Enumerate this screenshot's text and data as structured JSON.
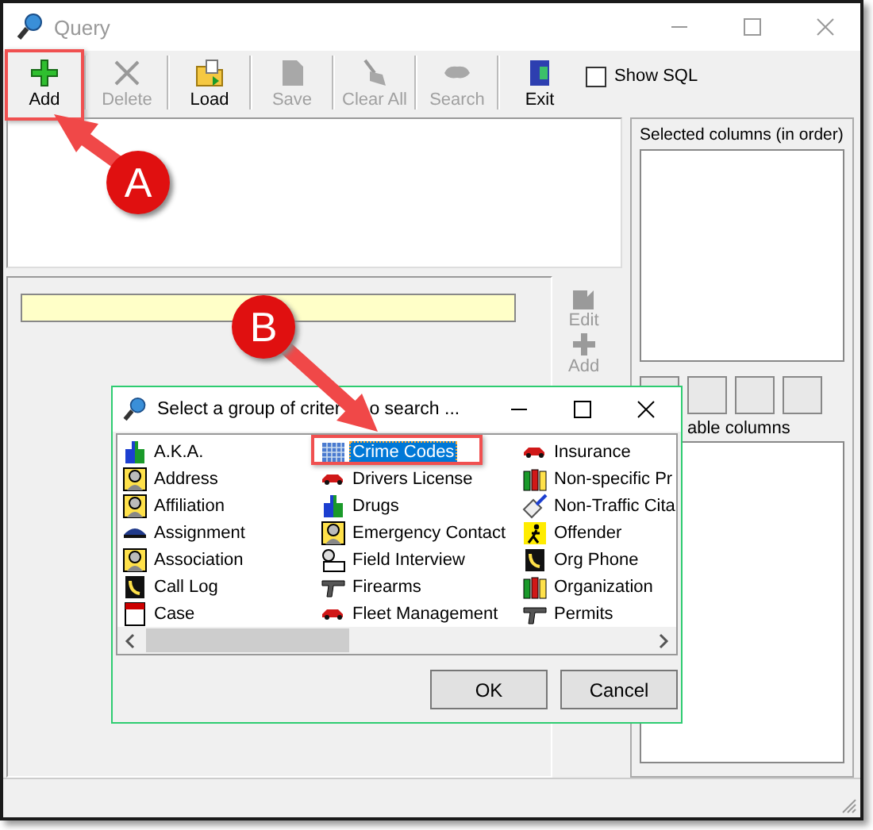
{
  "window": {
    "title": "Query"
  },
  "toolbar": [
    {
      "label": "Add",
      "disabled": false
    },
    {
      "label": "Delete",
      "disabled": true
    },
    {
      "label": "Load",
      "disabled": false
    },
    {
      "label": "Save",
      "disabled": true
    },
    {
      "label": "Clear All",
      "disabled": true
    },
    {
      "label": "Search",
      "disabled": true
    },
    {
      "label": "Exit",
      "disabled": false
    }
  ],
  "show_sql": {
    "label": "Show SQL",
    "checked": false
  },
  "side_buttons": [
    {
      "label": "Edit",
      "disabled": true
    },
    {
      "label": "Add",
      "disabled": true
    }
  ],
  "right_panel": {
    "selected_label": "Selected columns (in order)",
    "available_label": "able columns"
  },
  "dialog": {
    "title_parts": [
      "Select a group of criter",
      "o search ..."
    ],
    "items": [
      {
        "label": "A.K.A.",
        "selected": false
      },
      {
        "label": "Address",
        "selected": false
      },
      {
        "label": "Affiliation",
        "selected": false
      },
      {
        "label": "Assignment",
        "selected": false
      },
      {
        "label": "Association",
        "selected": false
      },
      {
        "label": "Call Log",
        "selected": false
      },
      {
        "label": "Case",
        "selected": false
      },
      {
        "label": "Crime Codes",
        "selected": true
      },
      {
        "label": "Drivers License",
        "selected": false
      },
      {
        "label": "Drugs",
        "selected": false
      },
      {
        "label": "Emergency Contact",
        "selected": false
      },
      {
        "label": "Field Interview",
        "selected": false
      },
      {
        "label": "Firearms",
        "selected": false
      },
      {
        "label": "Fleet Management",
        "selected": false
      },
      {
        "label": "Insurance",
        "selected": false
      },
      {
        "label": "Non-specific Pr",
        "selected": false
      },
      {
        "label": "Non-Traffic Cita",
        "selected": false
      },
      {
        "label": "Offender",
        "selected": false
      },
      {
        "label": "Org Phone",
        "selected": false
      },
      {
        "label": "Organization",
        "selected": false
      },
      {
        "label": "Permits",
        "selected": false
      }
    ],
    "buttons": [
      "OK",
      "Cancel"
    ]
  },
  "annotations": [
    {
      "label": "A"
    },
    {
      "label": "B"
    }
  ]
}
